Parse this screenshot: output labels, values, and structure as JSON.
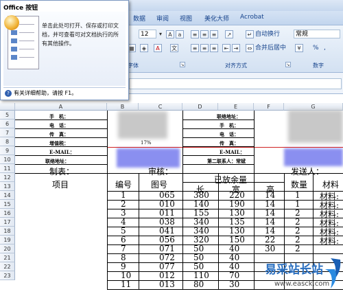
{
  "ribbon": {
    "tabs": [
      "数据",
      "审阅",
      "视图",
      "美化大师",
      "Acrobat"
    ],
    "font_size": "12",
    "wrap_label": "自动换行",
    "merge_label": "合并后居中",
    "number_format": "常规",
    "group_font": "字体",
    "group_align": "对齐方式",
    "group_number": "数字",
    "percent_symbol": "%",
    "comma_symbol": ","
  },
  "popup": {
    "title": "Office 按钮",
    "description": "单击此处可打开、保存或打印文档，并可查看可对文档执行的所有其他操作。",
    "help": "有关详细帮助，请按 F1。"
  },
  "columns": [
    "A",
    "B",
    "C",
    "D",
    "E",
    "F",
    "G"
  ],
  "rows": [
    "5",
    "6",
    "7",
    "8",
    "9",
    "10",
    "11",
    "12",
    "13",
    "14",
    "15",
    "16",
    "17",
    "18",
    "19",
    "20",
    "21",
    "22",
    "23"
  ],
  "sheet": {
    "phone": "手　机：",
    "tel": "电　话：",
    "fax": "传　真：",
    "vat": "增值税：",
    "email": "E-MAIL：",
    "address": "联络地址：",
    "rate": "17%",
    "contact_addr": "联络地址：",
    "phone2": "手　机：",
    "tel2": "电　话：",
    "fax2": "传　真：",
    "email2": "E-MAIL：",
    "second_contact": "第二联系人：常斌",
    "maker": "制表：",
    "reviewer": "审核：",
    "sender": "发送人：",
    "h_item": "项目",
    "h_no": "编号",
    "h_fig": "图号",
    "h_allow": "已放余量",
    "h_len": "长",
    "h_wid": "宽",
    "h_hgt": "高",
    "h_qty": "数量",
    "h_mat": "材料"
  },
  "table_rows": [
    {
      "no": "1",
      "fig": "065",
      "l": "380",
      "w": "220",
      "h": "14",
      "q": "1",
      "m": "材料:"
    },
    {
      "no": "2",
      "fig": "010",
      "l": "140",
      "w": "190",
      "h": "14",
      "q": "1",
      "m": "材料:"
    },
    {
      "no": "3",
      "fig": "011",
      "l": "155",
      "w": "130",
      "h": "14",
      "q": "2",
      "m": "材料:"
    },
    {
      "no": "4",
      "fig": "038",
      "l": "340",
      "w": "135",
      "h": "14",
      "q": "2",
      "m": "材料:"
    },
    {
      "no": "5",
      "fig": "041",
      "l": "340",
      "w": "130",
      "h": "14",
      "q": "2",
      "m": "材料:"
    },
    {
      "no": "6",
      "fig": "056",
      "l": "320",
      "w": "150",
      "h": "22",
      "q": "2",
      "m": "材料:"
    },
    {
      "no": "7",
      "fig": "071",
      "l": "50",
      "w": "40",
      "h": "30",
      "q": "2",
      "m": ""
    },
    {
      "no": "8",
      "fig": "072",
      "l": "50",
      "w": "40",
      "h": "",
      "q": "",
      "m": ""
    },
    {
      "no": "9",
      "fig": "077",
      "l": "50",
      "w": "40",
      "h": "",
      "q": "",
      "m": ""
    },
    {
      "no": "10",
      "fig": "012",
      "l": "110",
      "w": "70",
      "h": "",
      "q": "",
      "m": ""
    },
    {
      "no": "11",
      "fig": "013",
      "l": "80",
      "w": "30",
      "h": "",
      "q": "",
      "m": ""
    }
  ],
  "watermark": {
    "cn": "易采站长站",
    "url": "www.easck.com"
  }
}
